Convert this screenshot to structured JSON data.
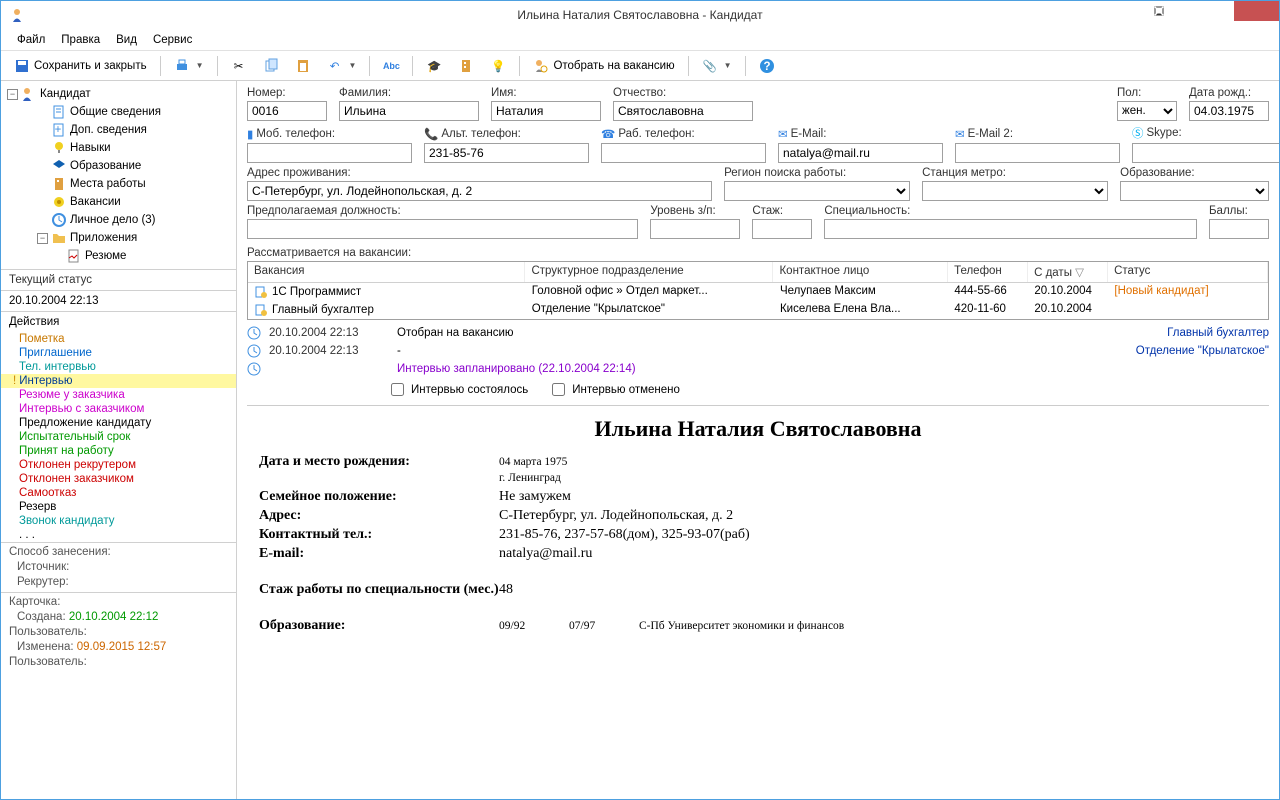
{
  "window": {
    "title": "Ильина Наталия Святославовна - Кандидат"
  },
  "menu": {
    "file": "Файл",
    "edit": "Правка",
    "view": "Вид",
    "service": "Сервис"
  },
  "toolbar": {
    "save_close": "Сохранить и закрыть",
    "select_vacancy": "Отобрать на вакансию"
  },
  "tree": {
    "root": "Кандидат",
    "items": [
      "Общие сведения",
      "Доп. сведения",
      "Навыки",
      "Образование",
      "Места работы",
      "Вакансии",
      "Личное дело  (3)"
    ],
    "attachments": "Приложения",
    "resume": "Резюме"
  },
  "left": {
    "status_title": "Текущий статус",
    "status_date": "20.10.2004 22:13",
    "actions_title": "Действия"
  },
  "actions": [
    {
      "t": "Пометка",
      "c": "act-orange"
    },
    {
      "t": "Приглашение",
      "c": "act-blue"
    },
    {
      "t": "Тел. интервью",
      "c": "act-teal"
    },
    {
      "t": "Интервью",
      "c": "act-navy",
      "sel": true
    },
    {
      "t": "Резюме у заказчика",
      "c": "act-mag"
    },
    {
      "t": "Интервью с заказчиком",
      "c": "act-mag"
    },
    {
      "t": "Предложение кандидату",
      "c": ""
    },
    {
      "t": "Испытательный срок",
      "c": "act-green"
    },
    {
      "t": "Принят на работу",
      "c": "act-green"
    },
    {
      "t": "Отклонен рекрутером",
      "c": "act-red"
    },
    {
      "t": "Отклонен заказчиком",
      "c": "act-red"
    },
    {
      "t": "Самоотказ",
      "c": "act-red"
    },
    {
      "t": "Резерв",
      "c": ""
    },
    {
      "t": "Звонок кандидату",
      "c": "act-teal"
    },
    {
      "t": ". . .",
      "c": ""
    }
  ],
  "info": {
    "method": "Способ занесения:",
    "source": "Источник:",
    "recruiter": "Рекрутер:",
    "card": "Карточка:",
    "created_l": "Создана:",
    "created_v": "20.10.2004 22:12",
    "user_l": "Пользователь:",
    "changed_l": "Изменена:",
    "changed_v": "09.09.2015 12:57"
  },
  "form": {
    "number_l": "Номер:",
    "number_v": "0016",
    "last_l": "Фамилия:",
    "last_v": "Ильина",
    "first_l": "Имя:",
    "first_v": "Наталия",
    "mid_l": "Отчество:",
    "mid_v": "Святославовна",
    "sex_l": "Пол:",
    "sex_v": "жен.",
    "dob_l": "Дата рожд.:",
    "dob_v": "04.03.1975",
    "mob_l": "Моб. телефон:",
    "mob_v": "",
    "alt_l": "Альт. телефон:",
    "alt_v": "231-85-76",
    "work_l": "Раб. телефон:",
    "work_v": "",
    "email_l": "E-Mail:",
    "email_v": "natalya@mail.ru",
    "email2_l": "E-Mail 2:",
    "email2_v": "",
    "skype_l": "Skype:",
    "skype_v": "",
    "addr_l": "Адрес проживания:",
    "addr_v": "С-Петербург, ул. Лодейнопольская, д. 2",
    "region_l": "Регион поиска работы:",
    "metro_l": "Станция метро:",
    "edu_l": "Образование:",
    "pos_l": "Предполагаемая должность:",
    "salary_l": "Уровень з/п:",
    "exp_l": "Стаж:",
    "spec_l": "Специальность:",
    "score_l": "Баллы:"
  },
  "grid": {
    "title": "Рассматривается на вакансии:",
    "h": {
      "vac": "Вакансия",
      "dept": "Структурное подразделение",
      "contact": "Контактное лицо",
      "phone": "Телефон",
      "date": "С даты",
      "status": "Статус"
    },
    "rows": [
      {
        "vac": "1С Программист",
        "dept": "Головной офис  »  Отдел маркет...",
        "contact": "Челупаев Максим",
        "phone": "444-55-66",
        "date": "20.10.2004",
        "status": "[Новый кандидат]"
      },
      {
        "vac": "Главный бухгалтер",
        "dept": "Отделение \"Крылатское\"",
        "contact": "Киселева Елена Вла...",
        "phone": "420-11-60",
        "date": "20.10.2004",
        "status": ""
      }
    ]
  },
  "log": {
    "l1_date": "20.10.2004  22:13",
    "l1_text": "Отобран на вакансию",
    "l2_date": "20.10.2004  22:13",
    "l2_text": "-",
    "l3_text": "Интервью запланировано  (22.10.2004  22:14)",
    "r1": "Главный бухгалтер",
    "r2": "Отделение \"Крылатское\"",
    "cb1": "Интервью состоялось",
    "cb2": "Интервью отменено"
  },
  "resume": {
    "name": "Ильина Наталия Святославовна",
    "dob_l": "Дата и место рождения:",
    "dob_v1": "04 марта 1975",
    "dob_v2": "г. Ленинград",
    "fam_l": "Семейное положение:",
    "fam_v": "Не замужем",
    "addr_l": "Адрес:",
    "addr_v": "С-Петербург, ул. Лодейнопольская, д. 2",
    "tel_l": "Контактный тел.:",
    "tel_v": "231-85-76, 237-57-68(дом), 325-93-07(раб)",
    "mail_l": "E-mail:",
    "mail_v": "natalya@mail.ru",
    "exp_l": "Стаж работы по специальности (мес.)",
    "exp_v": "48",
    "edu_l": "Образование:",
    "edu_d1": "09/92",
    "edu_d2": "07/97",
    "edu_v": "С-Пб Университет экономики и финансов"
  }
}
